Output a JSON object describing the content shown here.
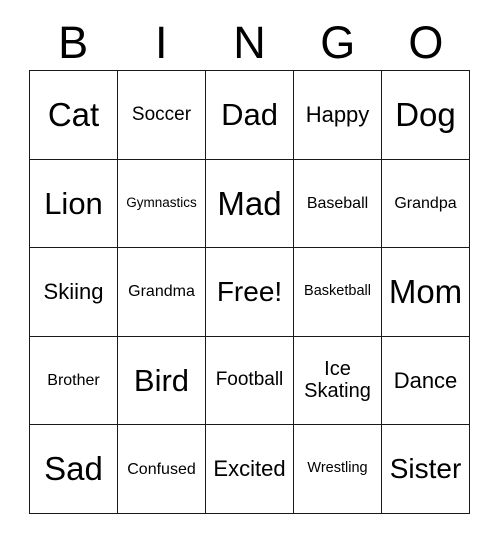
{
  "card": {
    "title": "Bingo Card",
    "background_color": "#ffffff",
    "border_color": "#1a1a1a",
    "text_color": "#000000",
    "columns": 5,
    "rows": 5
  },
  "header": {
    "letters": [
      {
        "label": "B"
      },
      {
        "label": "I"
      },
      {
        "label": "N"
      },
      {
        "label": "G"
      },
      {
        "label": "O"
      }
    ]
  },
  "grid": {
    "rows": [
      {
        "cells": [
          {
            "text": "Cat",
            "size": "fs-xxl"
          },
          {
            "text": "Soccer",
            "size": "fs-sm"
          },
          {
            "text": "Dad",
            "size": "fs-xl"
          },
          {
            "text": "Happy",
            "size": "fs-md"
          },
          {
            "text": "Dog",
            "size": "fs-xxl"
          }
        ]
      },
      {
        "cells": [
          {
            "text": "Lion",
            "size": "fs-xl"
          },
          {
            "text": "Gymnastics",
            "size": "fs-tiny"
          },
          {
            "text": "Mad",
            "size": "fs-xxl"
          },
          {
            "text": "Baseball",
            "size": "fs-xs"
          },
          {
            "text": "Grandpa",
            "size": "fs-xs"
          }
        ]
      },
      {
        "cells": [
          {
            "text": "Skiing",
            "size": "fs-md"
          },
          {
            "text": "Grandma",
            "size": "fs-xs"
          },
          {
            "text": "Free!",
            "size": "fs-lg",
            "free_space": true
          },
          {
            "text": "Basketball",
            "size": "fs-xxs"
          },
          {
            "text": "Mom",
            "size": "fs-xxl"
          }
        ]
      },
      {
        "cells": [
          {
            "text": "Brother",
            "size": "fs-xs"
          },
          {
            "text": "Bird",
            "size": "fs-xl"
          },
          {
            "text": "Football",
            "size": "fs-sm"
          },
          {
            "text": "Ice\nSkating",
            "size": "fs-two",
            "wrapped": true
          },
          {
            "text": "Dance",
            "size": "fs-md"
          }
        ]
      },
      {
        "cells": [
          {
            "text": "Sad",
            "size": "fs-xxl"
          },
          {
            "text": "Confused",
            "size": "fs-xs"
          },
          {
            "text": "Excited",
            "size": "fs-md"
          },
          {
            "text": "Wrestling",
            "size": "fs-xxs"
          },
          {
            "text": "Sister",
            "size": "fs-lg"
          }
        ]
      }
    ]
  }
}
